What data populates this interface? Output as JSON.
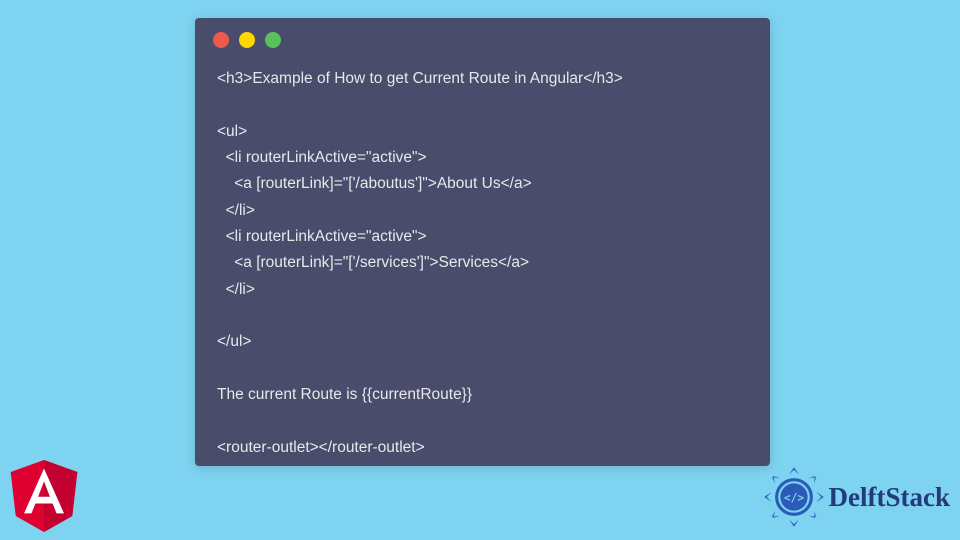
{
  "code": {
    "line1": "<h3>Example of How to get Current Route in Angular</h3>",
    "line2": "",
    "line3": "<ul>",
    "line4": "  <li routerLinkActive=\"active\">",
    "line5": "    <a [routerLink]=\"['/aboutus']\">About Us</a>",
    "line6": "  </li>",
    "line7": "  <li routerLinkActive=\"active\">",
    "line8": "    <a [routerLink]=\"['/services']\">Services</a>",
    "line9": "  </li>",
    "line10": "",
    "line11": "</ul>",
    "line12": "",
    "line13": "The current Route is {{currentRoute}}",
    "line14": "",
    "line15": "<router-outlet></router-outlet>"
  },
  "logos": {
    "angular_letter": "A",
    "delft_text": "DelftStack",
    "delft_symbol": "</>"
  }
}
